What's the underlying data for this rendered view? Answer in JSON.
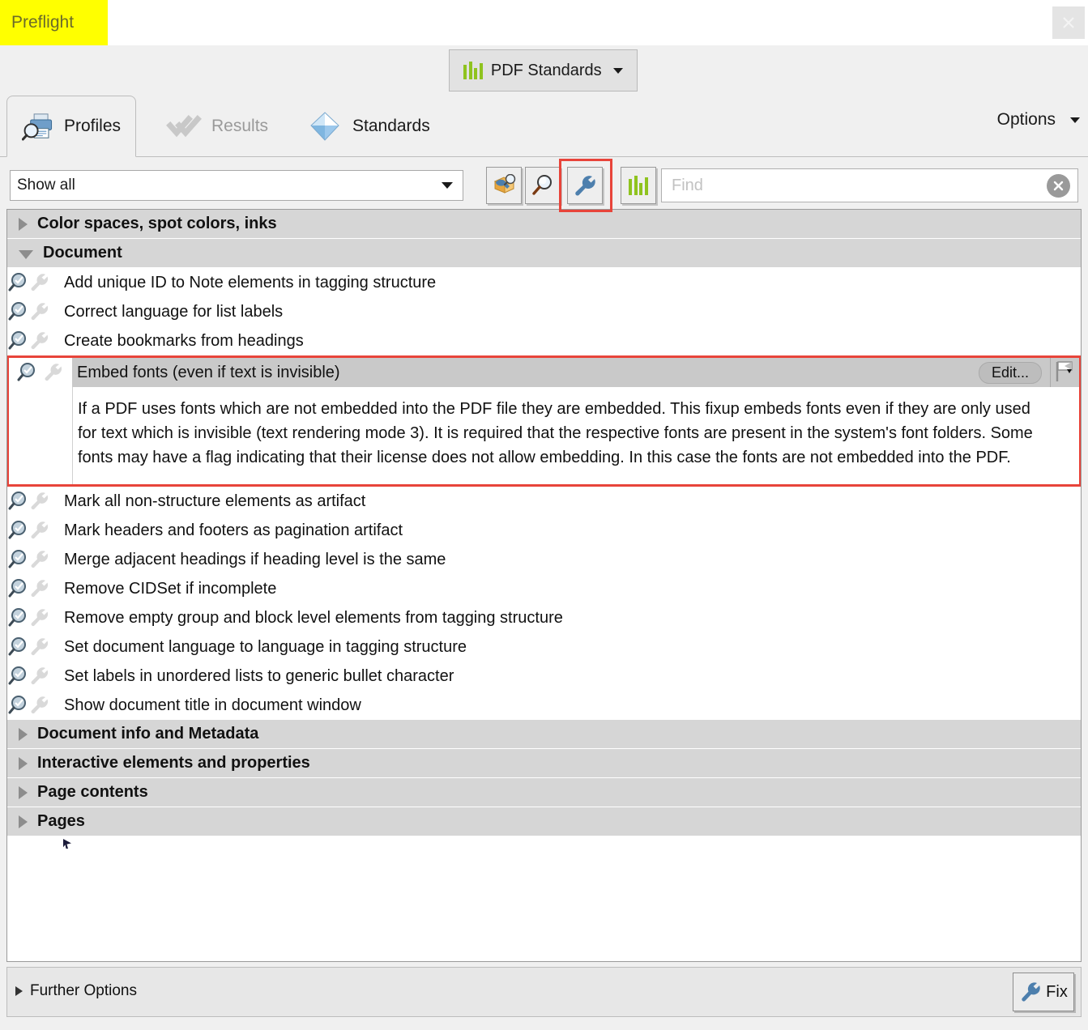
{
  "window": {
    "title": "Preflight",
    "close_label": "×",
    "close_icon": "close-icon"
  },
  "standards_button": {
    "label": "PDF Standards",
    "icon": "bar-chart-icon",
    "caret": "chevron-down-icon"
  },
  "tabs": [
    {
      "label": "Profiles",
      "icon": "printer-magnifier-icon",
      "active": true,
      "enabled": true
    },
    {
      "label": "Results",
      "icon": "checkmarks-icon",
      "active": false,
      "enabled": false
    },
    {
      "label": "Standards",
      "icon": "diamond-icon",
      "active": false,
      "enabled": true
    }
  ],
  "options": {
    "label": "Options",
    "caret": "chevron-down-icon"
  },
  "toolbar": {
    "filter": {
      "value": "Show all",
      "arrow": "chevron-down-icon"
    },
    "buttons": [
      {
        "name": "toolbox-wrench-magnifier-icon",
        "title": ""
      },
      {
        "name": "magnifier-icon",
        "title": ""
      },
      {
        "name": "wrench-icon",
        "title": "",
        "highlighted": true
      },
      {
        "name": "bar-chart-icon",
        "title": ""
      }
    ],
    "find": {
      "placeholder": "Find",
      "value": "",
      "clear_icon": "clear-circle-x-icon"
    }
  },
  "groups": [
    {
      "label": "Color spaces, spot colors, inks",
      "expanded": false
    },
    {
      "label": "Document",
      "expanded": true
    }
  ],
  "document_items_before": [
    "Add unique ID to Note elements in tagging structure",
    "Correct language for list labels",
    "Create bookmarks from headings"
  ],
  "selected_item": {
    "title": "Embed fonts (even if text is invisible)",
    "edit_label": "Edit...",
    "flag_icon": "flag-dropdown-icon",
    "description": "If a PDF uses fonts which are not embedded into the PDF file they are embedded. This fixup embeds fonts even if they are only used for text which is invisible (text rendering mode 3). It is required that the respective fonts are present in the system's font folders. Some fonts may have a flag indicating that their license does not allow embedding. In this case the fonts are not embedded into the PDF."
  },
  "document_items_after": [
    "Mark all non-structure elements as artifact",
    "Mark headers and footers as pagination artifact",
    "Merge adjacent headings if heading level is the same",
    "Remove CIDSet if incomplete",
    "Remove empty group and block level elements from tagging structure",
    "Set document language to language in tagging structure",
    "Set labels in unordered lists to generic bullet character",
    "Show document title in document window"
  ],
  "collapsed_groups": [
    "Document info and Metadata",
    "Interactive elements and properties",
    "Page contents",
    "Pages"
  ],
  "footer": {
    "further_options": "Further Options",
    "fix_label": "Fix",
    "fix_icon": "wrench-icon"
  },
  "colors": {
    "highlight_red": "#e8443a",
    "title_highlight": "#ffff00",
    "accent_green": "#8fc31f",
    "icon_blue": "#4d7fad",
    "group_header": "#d6d6d6"
  }
}
